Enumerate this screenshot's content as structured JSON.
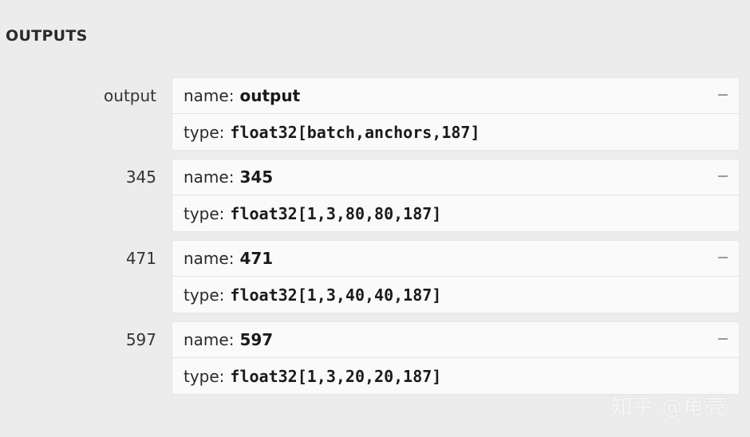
{
  "section": {
    "title": "OUTPUTS"
  },
  "outputs": [
    {
      "label": "output",
      "name_key": "name:",
      "name": "output",
      "type_key": "type:",
      "type": "float32[batch,anchors,187]"
    },
    {
      "label": "345",
      "name_key": "name:",
      "name": "345",
      "type_key": "type:",
      "type": "float32[1,3,80,80,187]"
    },
    {
      "label": "471",
      "name_key": "name:",
      "name": "471",
      "type_key": "type:",
      "type": "float32[1,3,40,40,187]"
    },
    {
      "label": "597",
      "name_key": "name:",
      "name": "597",
      "type_key": "type:",
      "type": "float32[1,3,20,20,187]"
    }
  ],
  "collapse_icon": "minus-icon",
  "watermark": "知乎 @龟壳"
}
